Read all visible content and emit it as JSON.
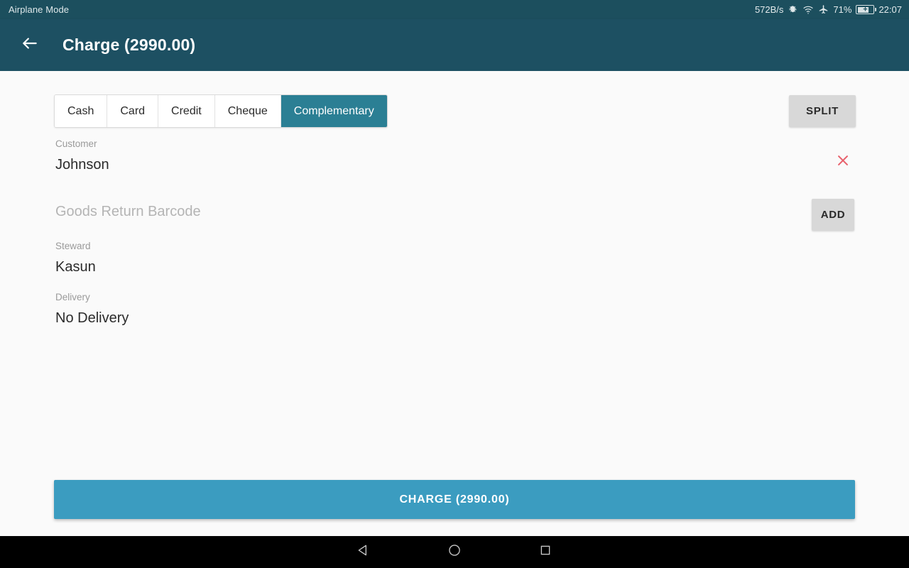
{
  "status_bar": {
    "left_text": "Airplane Mode",
    "net_rate": "572B/s",
    "icons": [
      "bug-icon",
      "wifi-icon",
      "airplane-icon"
    ],
    "battery_percent": "71%",
    "battery_icon": "battery-charging-icon",
    "clock": "22:07"
  },
  "app_bar": {
    "back_icon": "arrow-left-icon",
    "title": "Charge (2990.00)"
  },
  "payment_methods": {
    "options": [
      {
        "label": "Cash",
        "selected": false
      },
      {
        "label": "Card",
        "selected": false
      },
      {
        "label": "Credit",
        "selected": false
      },
      {
        "label": "Cheque",
        "selected": false
      },
      {
        "label": "Complementary",
        "selected": true
      }
    ],
    "selected": "Complementary",
    "split_label": "SPLIT"
  },
  "fields": {
    "customer": {
      "label": "Customer",
      "value": "Johnson",
      "clear_icon": "close-x-icon"
    },
    "barcode": {
      "placeholder": "Goods Return Barcode",
      "value": "",
      "add_label": "ADD"
    },
    "steward": {
      "label": "Steward",
      "value": "Kasun"
    },
    "delivery": {
      "label": "Delivery",
      "value": "No Delivery"
    }
  },
  "charge_button": {
    "label": "CHARGE (2990.00)"
  },
  "nav_bar": {
    "back_icon": "triangle-back-icon",
    "home_icon": "circle-home-icon",
    "recents_icon": "square-recents-icon"
  },
  "colors": {
    "status_bar": "#1c4f5e",
    "app_bar": "#1d5062",
    "accent_selected_tab": "#2b7f94",
    "charge_button": "#3b9cc0",
    "clear_x": "#e8606b",
    "page_background": "#fafafa"
  }
}
